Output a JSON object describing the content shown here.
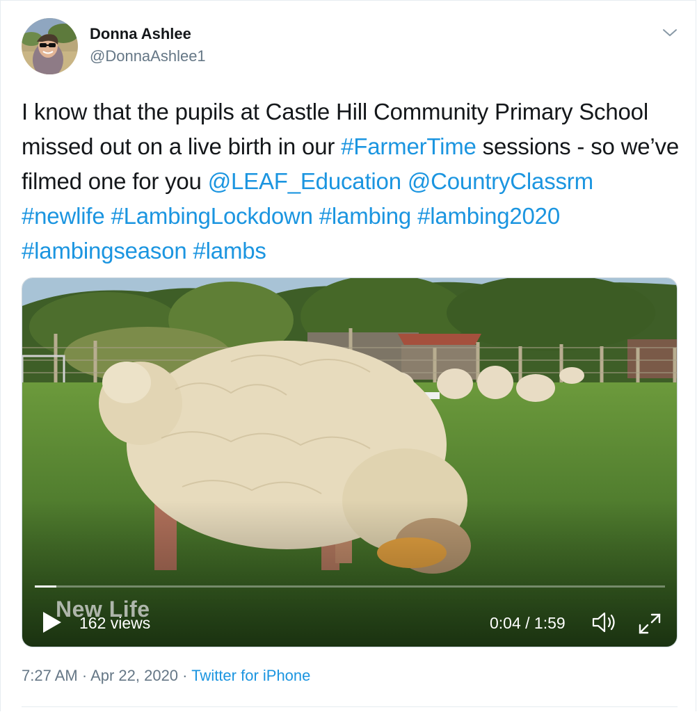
{
  "tweet": {
    "author": {
      "display_name": "Donna Ashlee",
      "handle": "@DonnaAshlee1"
    },
    "text_segments": [
      {
        "t": "I know that the pupils at Castle Hill Community Primary School missed out on a live birth in our ",
        "link": false
      },
      {
        "t": "#FarmerTime",
        "link": true
      },
      {
        "t": " sessions - so we’ve filmed one for you ",
        "link": false
      },
      {
        "t": "@LEAF_Education",
        "link": true
      },
      {
        "t": " ",
        "link": false
      },
      {
        "t": "@CountryClassrm",
        "link": true
      },
      {
        "t": " ",
        "link": false
      },
      {
        "t": "#newlife",
        "link": true
      },
      {
        "t": " ",
        "link": false
      },
      {
        "t": "#LambingLockdown",
        "link": true
      },
      {
        "t": " ",
        "link": false
      },
      {
        "t": "#lambing",
        "link": true
      },
      {
        "t": " ",
        "link": false
      },
      {
        "t": "#lambing2020",
        "link": true
      },
      {
        "t": " ",
        "link": false
      },
      {
        "t": "#lambingseason",
        "link": true
      },
      {
        "t": " ",
        "link": false
      },
      {
        "t": "#lambs",
        "link": true
      }
    ],
    "video": {
      "overlay_title": "New Life",
      "views": "162 views",
      "time_display": "0:04 / 1:59",
      "progress_fraction": 0.034
    },
    "footer": {
      "time": "7:27 AM",
      "separator1": " · ",
      "date": "Apr 22, 2020",
      "separator2": " · ",
      "source": "Twitter for iPhone"
    },
    "colors": {
      "link": "#1b95e0",
      "secondary_text": "#657786",
      "primary_text": "#14171a",
      "border": "#e6ecf0"
    },
    "icons": [
      "avatar-photo",
      "chevron-down-icon",
      "play-icon",
      "volume-icon",
      "fullscreen-icon"
    ]
  }
}
